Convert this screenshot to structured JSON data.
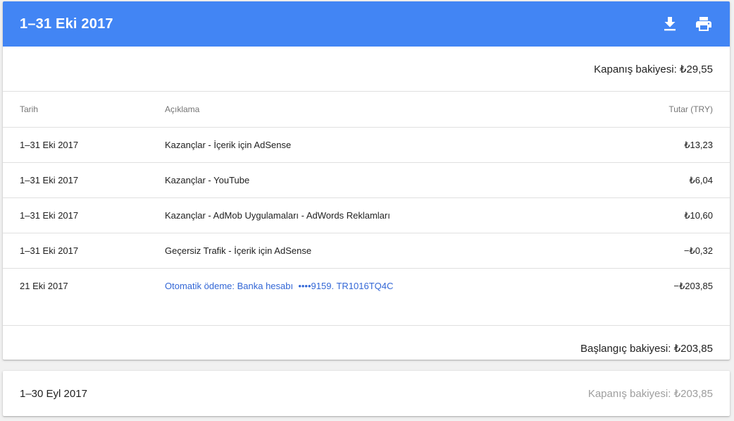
{
  "colors": {
    "header_bg": "#4285f4",
    "link": "#3367d6",
    "muted": "#757575"
  },
  "statement": {
    "title": "1–31 Eki 2017",
    "download_icon": "download-icon",
    "print_icon": "print-icon",
    "closing_balance": "Kapanış bakiyesi: ₺29,55",
    "columns": {
      "date": "Tarih",
      "description": "Açıklama",
      "amount": "Tutar (TRY)"
    },
    "rows": [
      {
        "date": "1–31 Eki 2017",
        "description": "Kazançlar - İçerik için AdSense",
        "amount": "₺13,23"
      },
      {
        "date": "1–31 Eki 2017",
        "description": "Kazançlar - YouTube",
        "amount": "₺6,04"
      },
      {
        "date": "1–31 Eki 2017",
        "description": "Kazançlar - AdMob Uygulamaları - AdWords Reklamları",
        "amount": "₺10,60"
      },
      {
        "date": "1–31 Eki 2017",
        "description": "Geçersiz Trafik - İçerik için AdSense",
        "amount": "−₺0,32"
      },
      {
        "date": "21 Eki 2017",
        "description": "Otomatik ödeme: Banka hesabı  ••••9159. TR1016TQ4C",
        "amount": "−₺203,85"
      }
    ],
    "opening_balance": "Başlangıç bakiyesi: ₺203,85"
  },
  "previous_statement": {
    "title": "1–30 Eyl 2017",
    "closing_balance": "Kapanış bakiyesi: ₺203,85"
  }
}
